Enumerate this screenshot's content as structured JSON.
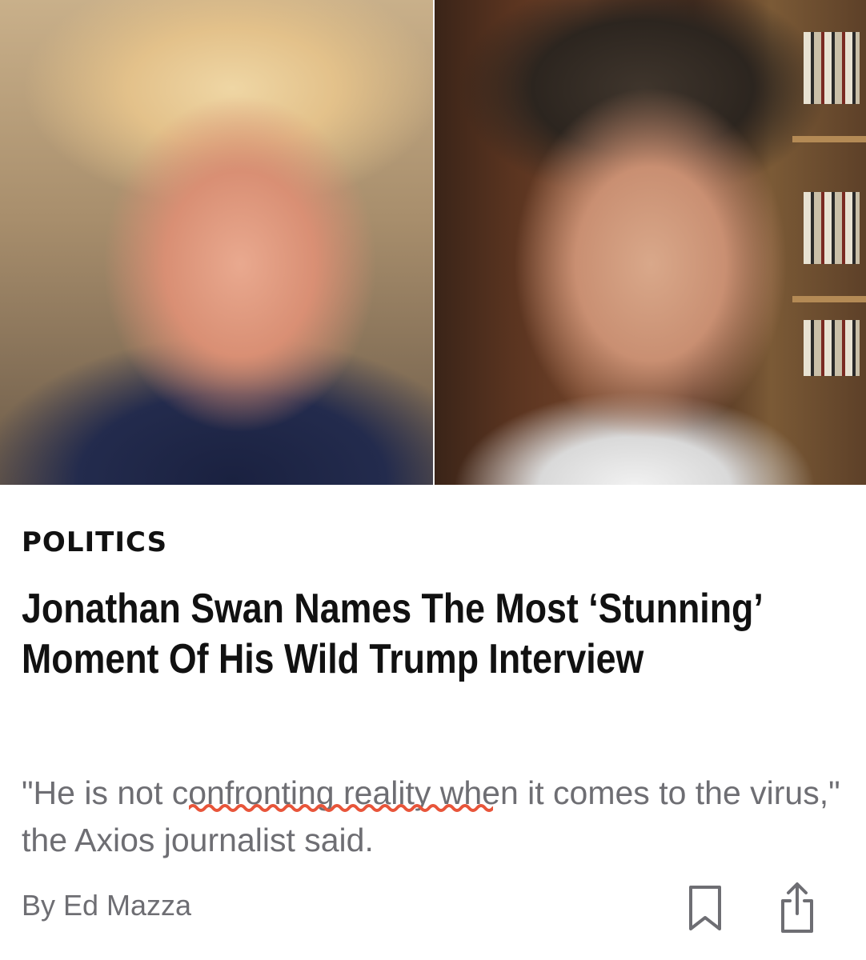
{
  "article": {
    "category": "POLITICS",
    "headline": "Jonathan Swan Names The Most ‘Stunning’ Moment Of His Wild Trump Interview",
    "deck": "\"He is not confronting reality when it comes to the virus,\" the Axios journalist said.",
    "byline": "By Ed Mazza"
  },
  "icons": {
    "bookmark": "bookmark-icon",
    "share": "share-icon"
  },
  "colors": {
    "headline": "#111111",
    "deck": "#6e6e73",
    "squiggle": "#e8553a",
    "icon_stroke": "#6e6e73"
  }
}
